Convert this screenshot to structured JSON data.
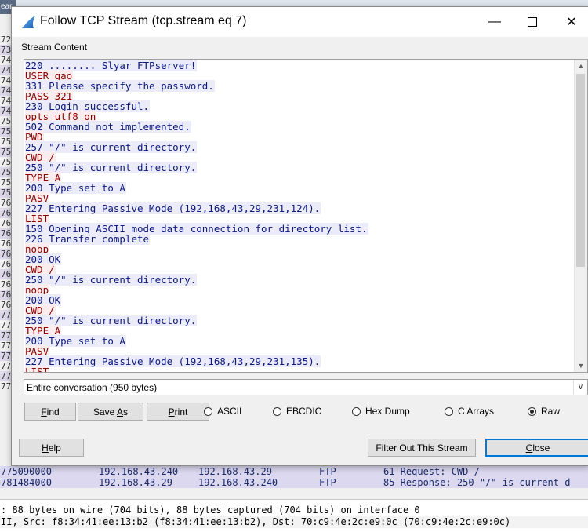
{
  "window": {
    "title": "Follow TCP Stream (tcp.stream eq 7)",
    "icon": "wireshark-fin-icon"
  },
  "stream": {
    "group_label": "Stream Content",
    "lines": [
      {
        "side": "server",
        "text": "220 ........ Slyar FTPserver!"
      },
      {
        "side": "client",
        "text": "USER gao"
      },
      {
        "side": "server",
        "text": "331 Please specify the password."
      },
      {
        "side": "client",
        "text": "PASS 321"
      },
      {
        "side": "server",
        "text": "230 Login successful."
      },
      {
        "side": "client",
        "text": "opts utf8 on"
      },
      {
        "side": "server",
        "text": "502 Command not implemented."
      },
      {
        "side": "client",
        "text": "PWD"
      },
      {
        "side": "server",
        "text": "257 \"/\" is current directory."
      },
      {
        "side": "client",
        "text": "CWD /"
      },
      {
        "side": "server",
        "text": "250 \"/\" is current directory."
      },
      {
        "side": "client",
        "text": "TYPE A"
      },
      {
        "side": "server",
        "text": "200 Type set to A"
      },
      {
        "side": "client",
        "text": "PASV"
      },
      {
        "side": "server",
        "text": "227 Entering Passive Mode (192,168,43,29,231,124)."
      },
      {
        "side": "client",
        "text": "LIST"
      },
      {
        "side": "server",
        "text": "150 Opening ASCII mode data connection for directory list."
      },
      {
        "side": "server",
        "text": "226 Transfer complete"
      },
      {
        "side": "client",
        "text": "noop"
      },
      {
        "side": "server",
        "text": "200 OK"
      },
      {
        "side": "client",
        "text": "CWD /"
      },
      {
        "side": "server",
        "text": "250 \"/\" is current directory."
      },
      {
        "side": "client",
        "text": "noop"
      },
      {
        "side": "server",
        "text": "200 OK"
      },
      {
        "side": "client",
        "text": "CWD /"
      },
      {
        "side": "server",
        "text": "250 \"/\" is current directory."
      },
      {
        "side": "client",
        "text": "TYPE A"
      },
      {
        "side": "server",
        "text": "200 Type set to A"
      },
      {
        "side": "client",
        "text": "PASV"
      },
      {
        "side": "server",
        "text": "227 Entering Passive Mode (192,168,43,29,231,135)."
      },
      {
        "side": "client",
        "text": "LIST"
      }
    ]
  },
  "conversation_select": {
    "value": "Entire conversation (950 bytes)"
  },
  "buttons": {
    "find": "Find",
    "save_as": "Save As",
    "print": "Print",
    "help": "Help",
    "filter_out": "Filter Out This Stream",
    "close": "Close"
  },
  "modes": [
    {
      "label": "ASCII",
      "selected": false
    },
    {
      "label": "EBCDIC",
      "selected": false
    },
    {
      "label": "Hex Dump",
      "selected": false
    },
    {
      "label": "C Arrays",
      "selected": false
    },
    {
      "label": "Raw",
      "selected": true
    }
  ],
  "background": {
    "top_left_text": "ear",
    "left_column": [
      "72",
      "73",
      "74",
      "74",
      "74",
      "74",
      "74",
      "74",
      "75",
      "75",
      "75",
      "75",
      "75",
      "75",
      "75",
      "75",
      "76",
      "76",
      "76",
      "76",
      "76",
      "76",
      "76",
      "76",
      "76",
      "76",
      "76",
      "77",
      "77",
      "77",
      "77",
      "77",
      "77",
      "77",
      "77"
    ],
    "packet_rows": [
      {
        "no": "775090000",
        "src": "192.168.43.240",
        "dst": "192.168.43.29",
        "proto": "FTP",
        "info": "61 Request: CWD /"
      },
      {
        "no": "781484000",
        "src": "192.168.43.29",
        "dst": "192.168.43.240",
        "proto": "FTP",
        "info": "85 Response: 250 \"/\" is current d"
      }
    ],
    "detail_line_1": ": 88 bytes on wire (704 bits), 88 bytes captured (704 bits) on interface 0",
    "detail_line_2": " II, Src: f8:34:41:ee:13:b2 (f8:34:41:ee:13:b2), Dst: 70:c9:4e:2c:e9:0c (70:c9:4e:2c:e9:0c)"
  },
  "colors": {
    "client_text": "#8b0000",
    "client_bg": "#fbeded",
    "server_text": "#0c1a7a",
    "server_bg": "#ecebf9",
    "default_button_border": "#0078d7"
  }
}
